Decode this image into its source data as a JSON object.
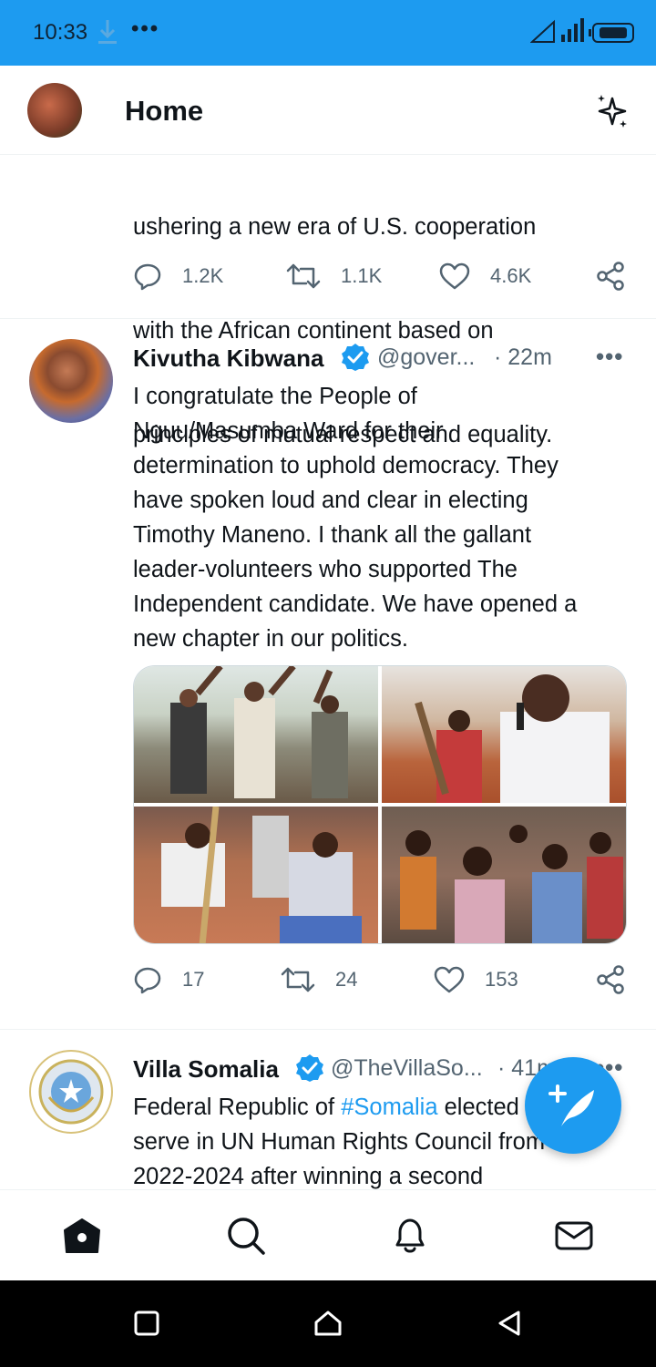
{
  "status_bar": {
    "time": "10:33",
    "more": "•••"
  },
  "header": {
    "title": "Home"
  },
  "tweets": [
    {
      "text_lines": [
        "ushering a new era of U.S. cooperation",
        "with the African continent based on",
        "principles of mutual respect and equality."
      ],
      "replies": "1.2K",
      "retweets": "1.1K",
      "likes": "4.6K"
    },
    {
      "name": "Kivutha Kibwana",
      "handle": "@gover...",
      "time": "· 22m",
      "more": "•••",
      "text": "I congratulate the People of\nNguu/Masumba Ward for their\ndetermination to uphold democracy. They\nhave spoken loud and clear in electing\nTimothy Maneno. I thank all the gallant\nleader-volunteers who supported The\nIndependent candidate. We have opened a\nnew chapter in our politics.",
      "replies": "17",
      "retweets": "24",
      "likes": "153"
    },
    {
      "name": "Villa Somalia",
      "handle": "@TheVillaSo...",
      "time": "· 41m",
      "more": "•••",
      "text_before": "Federal Republic of ",
      "hashtag": "#Somalia",
      "text_after": " elected to\nserve in UN Human Rights Council from\n2022-2024 after winning a second"
    }
  ],
  "colors": {
    "accent": "#1d9bf0",
    "text": "#0f1419",
    "secondary": "#536471"
  },
  "icons": [
    "download-icon",
    "sparkle-icon",
    "reply-icon",
    "retweet-icon",
    "like-icon",
    "share-icon",
    "verified-icon",
    "compose-icon",
    "home-icon",
    "search-icon",
    "notifications-icon",
    "messages-icon",
    "recents-icon",
    "home-sys-icon",
    "back-icon"
  ]
}
